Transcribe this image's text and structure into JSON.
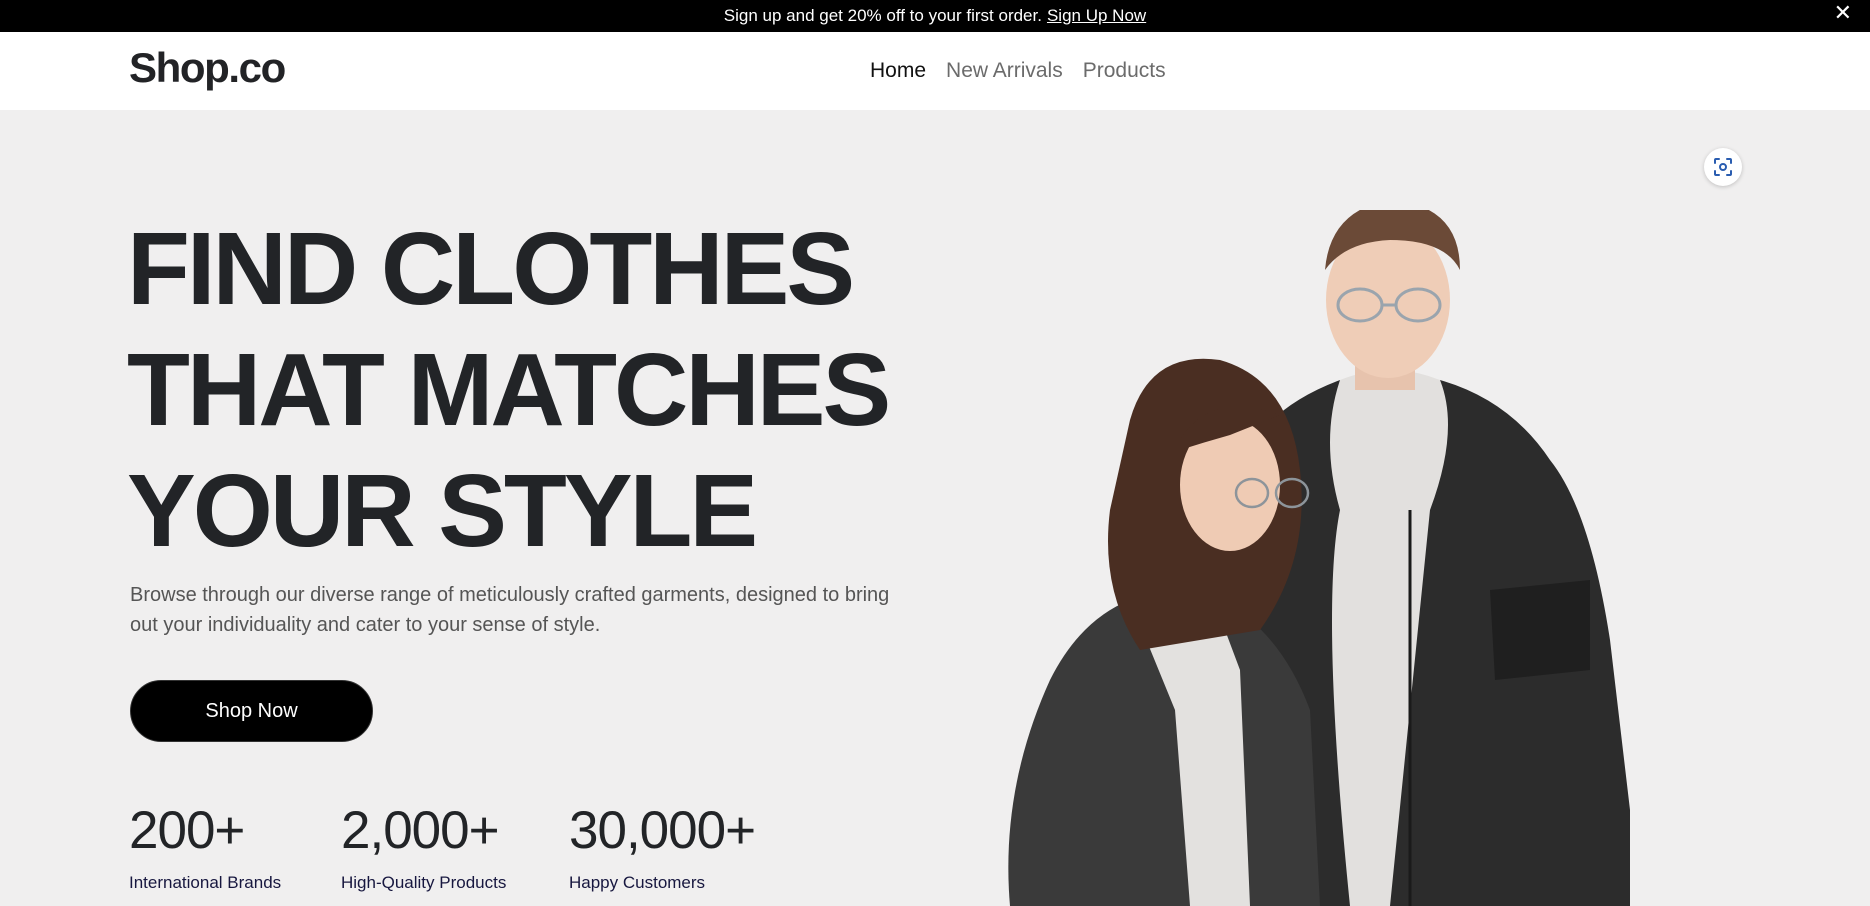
{
  "announcement": {
    "text": "Sign up and get 20% off to your first order.",
    "link_label": "Sign Up Now",
    "close_glyph": "✕"
  },
  "header": {
    "logo": "Shop.co",
    "nav": [
      {
        "label": "Home",
        "active": true
      },
      {
        "label": "New Arrivals",
        "active": false
      },
      {
        "label": "Products",
        "active": false
      }
    ]
  },
  "hero": {
    "headline_lines": [
      "FIND CLOTHES",
      "THAT MATCHES",
      "YOUR STYLE"
    ],
    "description": "Browse through our diverse range of meticulously crafted garments, designed to bring out your individuality and cater to your sense of style.",
    "cta_label": "Shop Now",
    "stats": [
      {
        "value": "200+",
        "label": "International Brands"
      },
      {
        "value": "2,000+",
        "label": "High-Quality Products"
      },
      {
        "value": "30,000+",
        "label": "Happy Customers"
      }
    ],
    "image_icon": "visual-search-icon"
  },
  "colors": {
    "announcement_bg": "#000000",
    "hero_bg": "#f0efef",
    "headline": "#222427",
    "cta_bg": "#000000"
  }
}
